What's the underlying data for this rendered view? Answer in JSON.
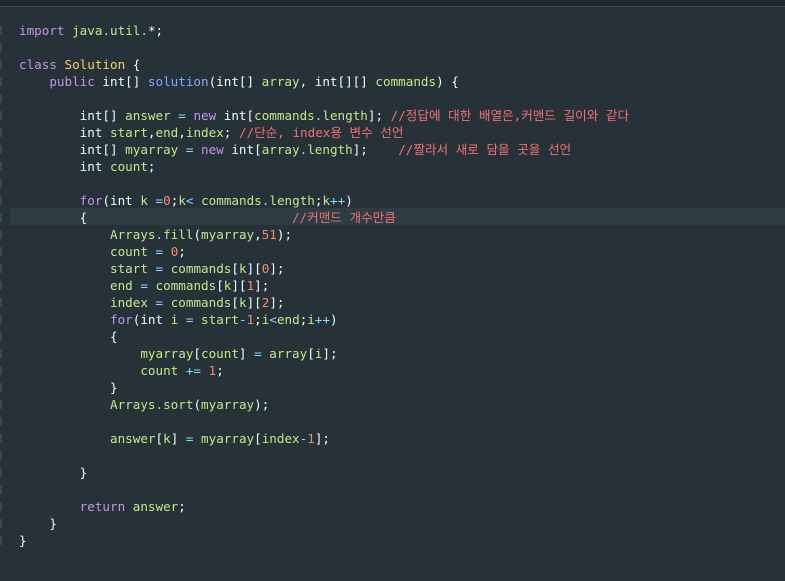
{
  "colors": {
    "background": "#263238",
    "current_line": "#2e3c43",
    "keyword": "#c792ea",
    "class_name": "#ffcb6b",
    "function": "#82aaff",
    "variable": "#c3e88d",
    "number": "#f78c6c",
    "operator": "#89ddff",
    "comment": "#f07178",
    "plain": "#eeffff"
  },
  "code": {
    "language": "java",
    "lines": [
      [
        [
          "kw",
          "import"
        ],
        [
          "pl",
          " "
        ],
        [
          "pk",
          "java"
        ],
        [
          "op",
          "."
        ],
        [
          "pk",
          "util"
        ],
        [
          "op",
          "."
        ],
        [
          "pl",
          "*;"
        ]
      ],
      [],
      [
        [
          "kw",
          "class"
        ],
        [
          "pl",
          " "
        ],
        [
          "cls",
          "Solution"
        ],
        [
          "pl",
          " {"
        ]
      ],
      [
        [
          "pl",
          "    "
        ],
        [
          "kw",
          "public"
        ],
        [
          "pl",
          " int[] "
        ],
        [
          "fn",
          "solution"
        ],
        [
          "pl",
          "(int[] "
        ],
        [
          "var",
          "array"
        ],
        [
          "pl",
          ", int[][] "
        ],
        [
          "var",
          "commands"
        ],
        [
          "pl",
          ") {"
        ]
      ],
      [],
      [
        [
          "pl",
          "        int[] "
        ],
        [
          "var",
          "answer"
        ],
        [
          "pl",
          " "
        ],
        [
          "op",
          "="
        ],
        [
          "pl",
          " "
        ],
        [
          "kw",
          "new"
        ],
        [
          "pl",
          " int["
        ],
        [
          "var",
          "commands"
        ],
        [
          "op",
          "."
        ],
        [
          "var",
          "length"
        ],
        [
          "pl",
          "]; "
        ],
        [
          "cm",
          "//정답에 대한 배열은,커맨드 길이와 같다"
        ]
      ],
      [
        [
          "pl",
          "        int "
        ],
        [
          "var",
          "start"
        ],
        [
          "pl",
          ","
        ],
        [
          "var",
          "end"
        ],
        [
          "pl",
          ","
        ],
        [
          "var",
          "index"
        ],
        [
          "pl",
          "; "
        ],
        [
          "cm",
          "//단순, index용 변수 선언"
        ]
      ],
      [
        [
          "pl",
          "        int[] "
        ],
        [
          "var",
          "myarray"
        ],
        [
          "pl",
          " "
        ],
        [
          "op",
          "="
        ],
        [
          "pl",
          " "
        ],
        [
          "kw",
          "new"
        ],
        [
          "pl",
          " int["
        ],
        [
          "var",
          "array"
        ],
        [
          "op",
          "."
        ],
        [
          "var",
          "length"
        ],
        [
          "pl",
          "];    "
        ],
        [
          "cm",
          "//짤라서 새로 담을 곳을 선언"
        ]
      ],
      [
        [
          "pl",
          "        int "
        ],
        [
          "var",
          "count"
        ],
        [
          "pl",
          ";"
        ]
      ],
      [],
      [
        [
          "pl",
          "        "
        ],
        [
          "kw",
          "for"
        ],
        [
          "pl",
          "(int "
        ],
        [
          "var",
          "k"
        ],
        [
          "pl",
          " "
        ],
        [
          "op",
          "="
        ],
        [
          "num",
          "0"
        ],
        [
          "pl",
          ";"
        ],
        [
          "var",
          "k"
        ],
        [
          "op",
          "<"
        ],
        [
          "pl",
          " "
        ],
        [
          "var",
          "commands"
        ],
        [
          "op",
          "."
        ],
        [
          "var",
          "length"
        ],
        [
          "pl",
          ";"
        ],
        [
          "var",
          "k"
        ],
        [
          "op",
          "++"
        ],
        [
          "pl",
          ")"
        ]
      ],
      [
        [
          "pl",
          "        {                           "
        ],
        [
          "cm",
          "//커맨드 개수만큼"
        ]
      ],
      [
        [
          "pl",
          "            "
        ],
        [
          "var",
          "Arrays"
        ],
        [
          "op",
          "."
        ],
        [
          "var",
          "fill"
        ],
        [
          "pl",
          "("
        ],
        [
          "var",
          "myarray"
        ],
        [
          "pl",
          ","
        ],
        [
          "num",
          "51"
        ],
        [
          "pl",
          ");"
        ]
      ],
      [
        [
          "pl",
          "            "
        ],
        [
          "var",
          "count"
        ],
        [
          "pl",
          " "
        ],
        [
          "op",
          "="
        ],
        [
          "pl",
          " "
        ],
        [
          "num",
          "0"
        ],
        [
          "pl",
          ";"
        ]
      ],
      [
        [
          "pl",
          "            "
        ],
        [
          "var",
          "start"
        ],
        [
          "pl",
          " "
        ],
        [
          "op",
          "="
        ],
        [
          "pl",
          " "
        ],
        [
          "var",
          "commands"
        ],
        [
          "pl",
          "["
        ],
        [
          "var",
          "k"
        ],
        [
          "pl",
          "]["
        ],
        [
          "num",
          "0"
        ],
        [
          "pl",
          "];"
        ]
      ],
      [
        [
          "pl",
          "            "
        ],
        [
          "var",
          "end"
        ],
        [
          "pl",
          " "
        ],
        [
          "op",
          "="
        ],
        [
          "pl",
          " "
        ],
        [
          "var",
          "commands"
        ],
        [
          "pl",
          "["
        ],
        [
          "var",
          "k"
        ],
        [
          "pl",
          "]["
        ],
        [
          "num",
          "1"
        ],
        [
          "pl",
          "];"
        ]
      ],
      [
        [
          "pl",
          "            "
        ],
        [
          "var",
          "index"
        ],
        [
          "pl",
          " "
        ],
        [
          "op",
          "="
        ],
        [
          "pl",
          " "
        ],
        [
          "var",
          "commands"
        ],
        [
          "pl",
          "["
        ],
        [
          "var",
          "k"
        ],
        [
          "pl",
          "]["
        ],
        [
          "num",
          "2"
        ],
        [
          "pl",
          "];"
        ]
      ],
      [
        [
          "pl",
          "            "
        ],
        [
          "kw",
          "for"
        ],
        [
          "pl",
          "(int "
        ],
        [
          "var",
          "i"
        ],
        [
          "pl",
          " "
        ],
        [
          "op",
          "="
        ],
        [
          "pl",
          " "
        ],
        [
          "var",
          "start"
        ],
        [
          "op",
          "-"
        ],
        [
          "num",
          "1"
        ],
        [
          "pl",
          ";"
        ],
        [
          "var",
          "i"
        ],
        [
          "op",
          "<"
        ],
        [
          "var",
          "end"
        ],
        [
          "pl",
          ";"
        ],
        [
          "var",
          "i"
        ],
        [
          "op",
          "++"
        ],
        [
          "pl",
          ")"
        ]
      ],
      [
        [
          "pl",
          "            {"
        ]
      ],
      [
        [
          "pl",
          "                "
        ],
        [
          "var",
          "myarray"
        ],
        [
          "pl",
          "["
        ],
        [
          "var",
          "count"
        ],
        [
          "pl",
          "] "
        ],
        [
          "op",
          "="
        ],
        [
          "pl",
          " "
        ],
        [
          "var",
          "array"
        ],
        [
          "pl",
          "["
        ],
        [
          "var",
          "i"
        ],
        [
          "pl",
          "];"
        ]
      ],
      [
        [
          "pl",
          "                "
        ],
        [
          "var",
          "count"
        ],
        [
          "pl",
          " "
        ],
        [
          "op",
          "+="
        ],
        [
          "pl",
          " "
        ],
        [
          "num",
          "1"
        ],
        [
          "pl",
          ";"
        ]
      ],
      [
        [
          "pl",
          "            }"
        ]
      ],
      [
        [
          "pl",
          "            "
        ],
        [
          "var",
          "Arrays"
        ],
        [
          "op",
          "."
        ],
        [
          "var",
          "sort"
        ],
        [
          "pl",
          "("
        ],
        [
          "var",
          "myarray"
        ],
        [
          "pl",
          ");"
        ]
      ],
      [],
      [
        [
          "pl",
          "            "
        ],
        [
          "var",
          "answer"
        ],
        [
          "pl",
          "["
        ],
        [
          "var",
          "k"
        ],
        [
          "pl",
          "] "
        ],
        [
          "op",
          "="
        ],
        [
          "pl",
          " "
        ],
        [
          "var",
          "myarray"
        ],
        [
          "pl",
          "["
        ],
        [
          "var",
          "index"
        ],
        [
          "op",
          "-"
        ],
        [
          "num",
          "1"
        ],
        [
          "pl",
          "];"
        ]
      ],
      [],
      [
        [
          "pl",
          "        }"
        ]
      ],
      [],
      [
        [
          "pl",
          "        "
        ],
        [
          "kw",
          "return"
        ],
        [
          "pl",
          " "
        ],
        [
          "var",
          "answer"
        ],
        [
          "pl",
          ";"
        ]
      ],
      [
        [
          "pl",
          "    }"
        ]
      ],
      [
        [
          "pl",
          "}"
        ]
      ]
    ]
  }
}
